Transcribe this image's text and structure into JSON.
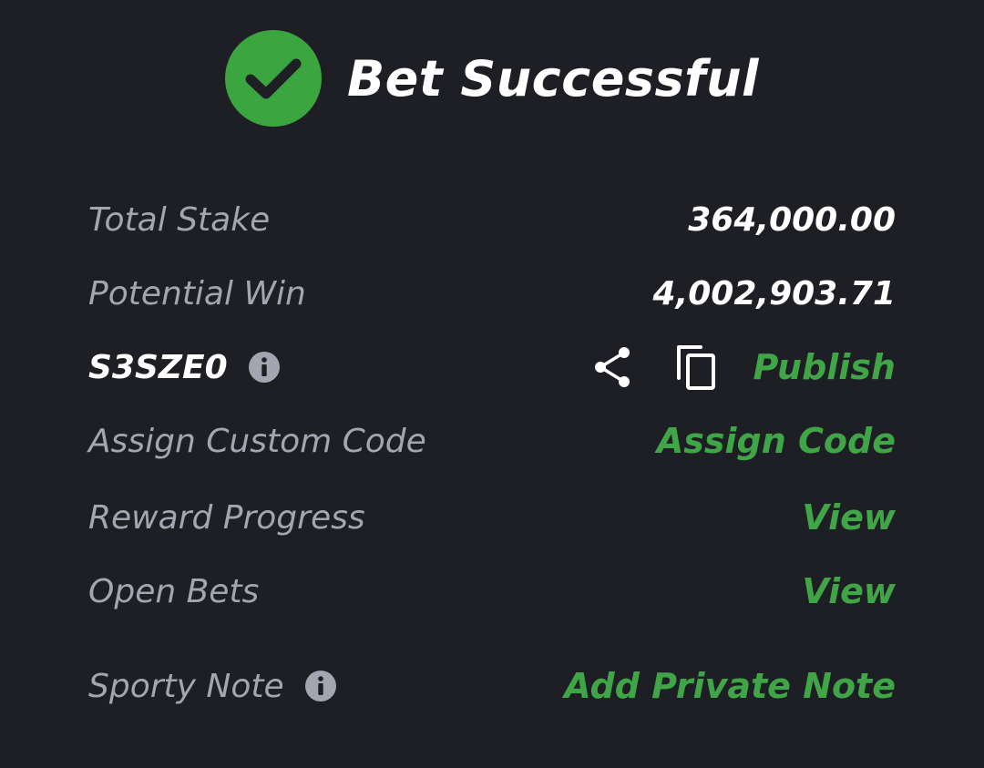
{
  "header": {
    "title": "Bet Successful"
  },
  "summary": {
    "total_stake_label": "Total Stake",
    "total_stake_value": "364,000.00",
    "potential_win_label": "Potential Win",
    "potential_win_value": "4,002,903.71",
    "booking_code": "S3SZE0",
    "publish_label": "Publish",
    "assign_custom_code_label": "Assign Custom Code",
    "assign_code_link": "Assign Code",
    "reward_progress_label": "Reward Progress",
    "reward_progress_link": "View",
    "open_bets_label": "Open Bets",
    "open_bets_link": "View",
    "sporty_note_label": "Sporty Note",
    "add_private_note_link": "Add Private Note"
  },
  "icons": {
    "success": "check-circle-icon",
    "info": "info-icon",
    "share": "share-icon",
    "copy": "copy-icon"
  },
  "colors": {
    "background": "#1e1f24",
    "accent_green": "#3fa546",
    "check_green": "#3ba53f",
    "label_gray": "#a3a5b0",
    "text_white": "#ffffff"
  }
}
